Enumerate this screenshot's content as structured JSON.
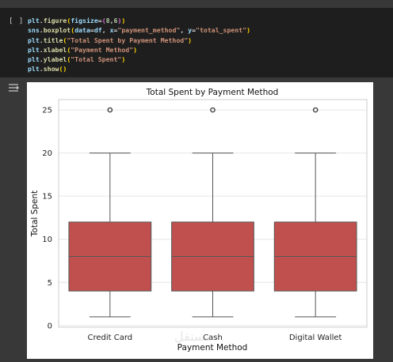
{
  "cell": {
    "run_label": "[ ]",
    "code_lines": [
      [
        {
          "t": "plt",
          "c": "tok-kw"
        },
        {
          "t": ".",
          "c": ""
        },
        {
          "t": "figure",
          "c": "tok-fn"
        },
        {
          "t": "(",
          "c": "tok-p1"
        },
        {
          "t": "figsize",
          "c": "tok-kw"
        },
        {
          "t": "=",
          "c": ""
        },
        {
          "t": "(",
          "c": "tok-p2"
        },
        {
          "t": "8",
          "c": "tok-num"
        },
        {
          "t": ",",
          "c": ""
        },
        {
          "t": "6",
          "c": "tok-num"
        },
        {
          "t": ")",
          "c": "tok-p2"
        },
        {
          "t": ")",
          "c": "tok-p1"
        }
      ],
      [
        {
          "t": "sns",
          "c": "tok-kw"
        },
        {
          "t": ".",
          "c": ""
        },
        {
          "t": "boxplot",
          "c": "tok-fn"
        },
        {
          "t": "(",
          "c": "tok-p1"
        },
        {
          "t": "data",
          "c": "tok-kw"
        },
        {
          "t": "=",
          "c": ""
        },
        {
          "t": "df",
          "c": "tok-kw"
        },
        {
          "t": ", ",
          "c": ""
        },
        {
          "t": "x",
          "c": "tok-kw"
        },
        {
          "t": "=",
          "c": ""
        },
        {
          "t": "\"payment_method\"",
          "c": "tok-str"
        },
        {
          "t": ", ",
          "c": ""
        },
        {
          "t": "y",
          "c": "tok-kw"
        },
        {
          "t": "=",
          "c": ""
        },
        {
          "t": "\"total_spent\"",
          "c": "tok-str"
        },
        {
          "t": ")",
          "c": "tok-p1"
        }
      ],
      [
        {
          "t": "plt",
          "c": "tok-kw"
        },
        {
          "t": ".",
          "c": ""
        },
        {
          "t": "title",
          "c": "tok-fn"
        },
        {
          "t": "(",
          "c": "tok-p1"
        },
        {
          "t": "\"Total Spent by Payment Method\"",
          "c": "tok-str"
        },
        {
          "t": ")",
          "c": "tok-p1"
        }
      ],
      [
        {
          "t": "plt",
          "c": "tok-kw"
        },
        {
          "t": ".",
          "c": ""
        },
        {
          "t": "xlabel",
          "c": "tok-fn"
        },
        {
          "t": "(",
          "c": "tok-p1"
        },
        {
          "t": "\"Payment Method\"",
          "c": "tok-str"
        },
        {
          "t": ")",
          "c": "tok-p1"
        }
      ],
      [
        {
          "t": "plt",
          "c": "tok-kw"
        },
        {
          "t": ".",
          "c": ""
        },
        {
          "t": "ylabel",
          "c": "tok-fn"
        },
        {
          "t": "(",
          "c": "tok-p1"
        },
        {
          "t": "\"Total Spent\"",
          "c": "tok-str"
        },
        {
          "t": ")",
          "c": "tok-p1"
        }
      ],
      [
        {
          "t": "plt",
          "c": "tok-kw"
        },
        {
          "t": ".",
          "c": ""
        },
        {
          "t": "show",
          "c": "tok-fn"
        },
        {
          "t": "(",
          "c": "tok-p1"
        },
        {
          "t": ")",
          "c": "tok-p1"
        }
      ]
    ]
  },
  "output": {
    "icon": "output-toggle-icon"
  },
  "chart_data": {
    "type": "box",
    "title": "Total Spent by Payment Method",
    "xlabel": "Payment Method",
    "ylabel": "Total Spent",
    "categories": [
      "Credit Card",
      "Cash",
      "Digital Wallet"
    ],
    "boxes": [
      {
        "category": "Credit Card",
        "whislo": 1,
        "q1": 4,
        "med": 8,
        "q3": 12,
        "whishi": 20,
        "fliers": [
          25
        ]
      },
      {
        "category": "Cash",
        "whislo": 1,
        "q1": 4,
        "med": 8,
        "q3": 12,
        "whishi": 20,
        "fliers": [
          25
        ]
      },
      {
        "category": "Digital Wallet",
        "whislo": 1,
        "q1": 4,
        "med": 8,
        "q3": 12,
        "whishi": 20,
        "fliers": [
          25
        ]
      }
    ],
    "yticks": [
      0,
      5,
      10,
      15,
      20,
      25
    ],
    "ylim": [
      -0.2,
      26.2
    ],
    "grid": true,
    "box_color": "#c0504d",
    "line_color": "#555555"
  },
  "watermark": "مستقل"
}
